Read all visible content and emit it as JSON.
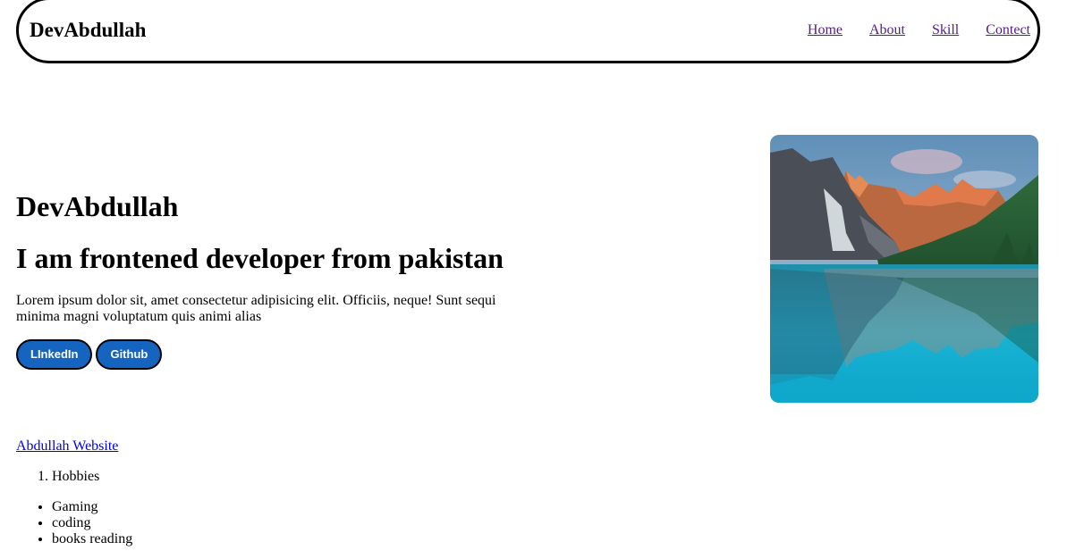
{
  "navbar": {
    "brand": "DevAbdullah",
    "links": [
      "Home",
      "About",
      "Skill",
      "Contect"
    ]
  },
  "hero": {
    "title": "DevAbdullah",
    "subtitle": "I am frontened developer from pakistan",
    "text": "Lorem ipsum dolor sit, amet consectetur adipisicing elit. Officiis, neque! Sunt sequi minima magni voluptatum quis animi alias",
    "buttons": [
      "LInkedIn",
      "Github"
    ]
  },
  "footer": {
    "website_link": "Abdullah Website",
    "ordered_items": [
      "Hobbies"
    ],
    "bullet_items": [
      "Gaming",
      "coding",
      "books reading"
    ]
  },
  "colors": {
    "button_bg": "#1565c0",
    "visited_link": "#551a8b",
    "link": "#0000ee"
  }
}
